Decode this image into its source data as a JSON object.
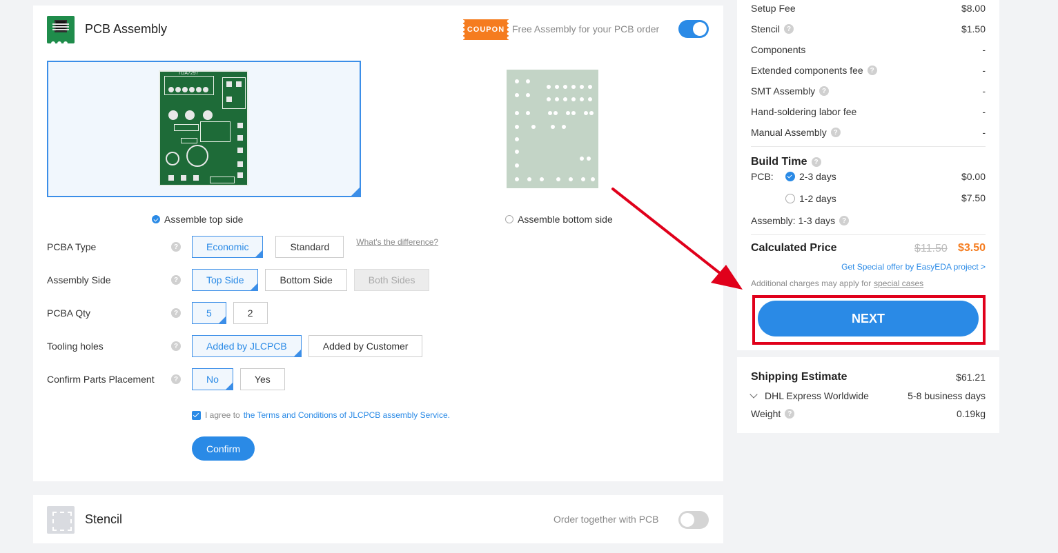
{
  "assembly": {
    "title": "PCB Assembly",
    "coupon_badge": "COUPON",
    "coupon_text": "Free Assembly for your PCB order",
    "assemble_top_label": "Assemble top side",
    "assemble_bottom_label": "Assemble bottom side",
    "board_label": "TDA7297",
    "pcba_type": {
      "label": "PCBA Type",
      "options": [
        "Economic",
        "Standard"
      ],
      "diff_link": "What's the difference?"
    },
    "assembly_side": {
      "label": "Assembly Side",
      "options": [
        "Top Side",
        "Bottom Side",
        "Both Sides"
      ]
    },
    "pcba_qty": {
      "label": "PCBA Qty",
      "options": [
        "5",
        "2"
      ]
    },
    "tooling_holes": {
      "label": "Tooling holes",
      "options": [
        "Added by JLCPCB",
        "Added by Customer"
      ]
    },
    "confirm_parts": {
      "label": "Confirm Parts Placement",
      "options": [
        "No",
        "Yes"
      ]
    },
    "agree_prefix": "I agree to",
    "agree_link": "the Terms and Conditions of JLCPCB assembly Service.",
    "confirm_button": "Confirm"
  },
  "stencil": {
    "title": "Stencil",
    "order_together": "Order together with PCB"
  },
  "price": {
    "rows": [
      {
        "label": "Setup Fee",
        "value": "$8.00",
        "help": false
      },
      {
        "label": "Stencil",
        "value": "$1.50",
        "help": true
      },
      {
        "label": "Components",
        "value": "-",
        "help": false
      },
      {
        "label": "Extended components fee",
        "value": "-",
        "help": true
      },
      {
        "label": "SMT Assembly",
        "value": "-",
        "help": true
      },
      {
        "label": "Hand-soldering labor fee",
        "value": "-",
        "help": false
      },
      {
        "label": "Manual Assembly",
        "value": "-",
        "help": true
      }
    ],
    "build_time_title": "Build Time",
    "pcb_label": "PCB:",
    "pcb_options": [
      {
        "label": "2-3 days",
        "price": "$0.00"
      },
      {
        "label": "1-2 days",
        "price": "$7.50"
      }
    ],
    "assembly_time": "Assembly:  1-3 days",
    "calculated_title": "Calculated Price",
    "old_price": "$11.50",
    "new_price": "$3.50",
    "special_offer": "Get Special offer by EasyEDA project >",
    "additional_prefix": "Additional charges may apply for",
    "special_cases": "special cases",
    "next_button": "NEXT"
  },
  "shipping": {
    "title": "Shipping Estimate",
    "amount": "$61.21",
    "method": "DHL Express Worldwide",
    "duration": "5-8 business days",
    "weight_label": "Weight",
    "weight_value": "0.19kg"
  },
  "colors": {
    "accent": "#2a8ae6",
    "coupon": "#f57c1f",
    "highlight": "#e0001b",
    "pcb_green": "#1e6b38"
  }
}
